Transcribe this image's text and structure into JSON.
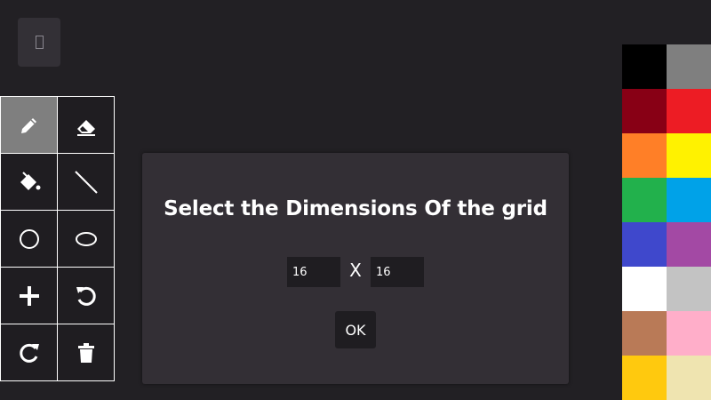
{
  "corner_button": {
    "icon": "mobile-phone-icon"
  },
  "tools": [
    {
      "name": "pencil",
      "icon": "pencil-icon",
      "active": true
    },
    {
      "name": "eraser",
      "icon": "eraser-icon",
      "active": false
    },
    {
      "name": "fill",
      "icon": "paint-bucket-icon",
      "active": false
    },
    {
      "name": "line",
      "icon": "line-icon",
      "active": false
    },
    {
      "name": "circle",
      "icon": "circle-icon",
      "active": false
    },
    {
      "name": "ellipse",
      "icon": "ellipse-icon",
      "active": false
    },
    {
      "name": "add",
      "icon": "plus-icon",
      "active": false
    },
    {
      "name": "undo",
      "icon": "undo-icon",
      "active": false
    },
    {
      "name": "redo",
      "icon": "redo-icon",
      "active": false
    },
    {
      "name": "clear",
      "icon": "trash-icon",
      "active": false
    }
  ],
  "palette": [
    "#000000",
    "#7f7f7f",
    "#880015",
    "#ed1c24",
    "#ff7f27",
    "#fff200",
    "#22b14c",
    "#00a2e8",
    "#3f48cc",
    "#a349a4",
    "#ffffff",
    "#c3c3c3",
    "#b97a57",
    "#ffaec9",
    "#ffc90e",
    "#efe4b0"
  ],
  "dialog": {
    "title": "Select the Dimensions Of the grid",
    "width_value": "16",
    "separator": "X",
    "height_value": "16",
    "ok_label": "OK"
  }
}
